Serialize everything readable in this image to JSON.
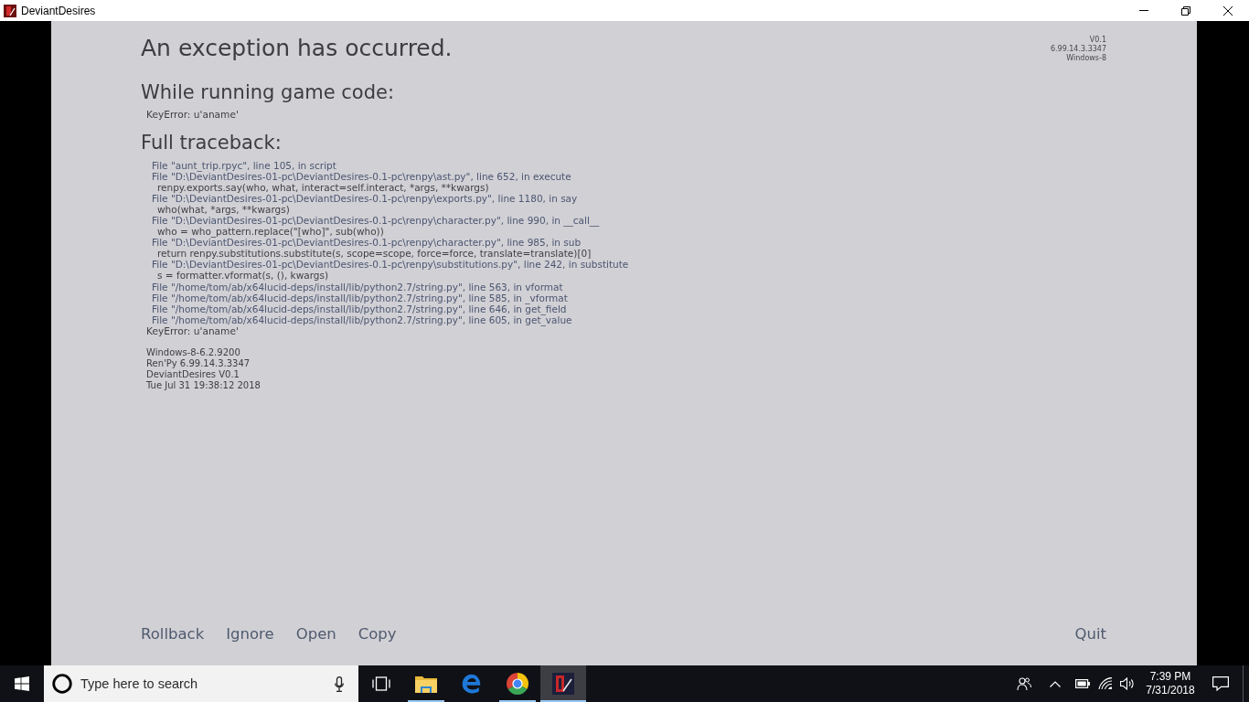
{
  "window": {
    "title": "DeviantDesires"
  },
  "version_info": [
    "V0.1",
    "6.99.14.3.3347",
    "Windows-8"
  ],
  "exception": {
    "heading": "An exception has occurred.",
    "game_code": {
      "heading": "While running game code:",
      "lines": [
        "KeyError: u'aname'"
      ]
    },
    "traceback": {
      "heading": "Full traceback:",
      "lines": [
        {
          "kind": "frame",
          "text": "File \"aunt_trip.rpyc\", line 105, in script"
        },
        {
          "kind": "frame",
          "text": "File \"D:\\DeviantDesires-01-pc\\DeviantDesires-0.1-pc\\renpy\\ast.py\", line 652, in execute"
        },
        {
          "kind": "code",
          "text": "renpy.exports.say(who, what, interact=self.interact, *args, **kwargs)"
        },
        {
          "kind": "frame",
          "text": "File \"D:\\DeviantDesires-01-pc\\DeviantDesires-0.1-pc\\renpy\\exports.py\", line 1180, in say"
        },
        {
          "kind": "code",
          "text": "who(what, *args, **kwargs)"
        },
        {
          "kind": "frame",
          "text": "File \"D:\\DeviantDesires-01-pc\\DeviantDesires-0.1-pc\\renpy\\character.py\", line 990, in __call__"
        },
        {
          "kind": "code",
          "text": "who = who_pattern.replace(\"[who]\", sub(who))"
        },
        {
          "kind": "frame",
          "text": "File \"D:\\DeviantDesires-01-pc\\DeviantDesires-0.1-pc\\renpy\\character.py\", line 985, in sub"
        },
        {
          "kind": "code",
          "text": "return renpy.substitutions.substitute(s, scope=scope, force=force, translate=translate)[0]"
        },
        {
          "kind": "frame",
          "text": "File \"D:\\DeviantDesires-01-pc\\DeviantDesires-0.1-pc\\renpy\\substitutions.py\", line 242, in substitute"
        },
        {
          "kind": "code",
          "text": "s = formatter.vformat(s, (), kwargs)"
        },
        {
          "kind": "frame",
          "text": "File \"/home/tom/ab/x64lucid-deps/install/lib/python2.7/string.py\", line 563, in vformat"
        },
        {
          "kind": "frame",
          "text": "File \"/home/tom/ab/x64lucid-deps/install/lib/python2.7/string.py\", line 585, in _vformat"
        },
        {
          "kind": "frame",
          "text": "File \"/home/tom/ab/x64lucid-deps/install/lib/python2.7/string.py\", line 646, in get_field"
        },
        {
          "kind": "frame",
          "text": "File \"/home/tom/ab/x64lucid-deps/install/lib/python2.7/string.py\", line 605, in get_value"
        },
        {
          "kind": "error",
          "text": "KeyError: u'aname'"
        }
      ]
    },
    "system_info": [
      "Windows-8-6.2.9200",
      "Ren'Py 6.99.14.3.3347",
      "DeviantDesires V0.1",
      "Tue Jul 31 19:38:12 2018"
    ]
  },
  "actions": [
    {
      "label": "Rollback"
    },
    {
      "label": "Ignore"
    },
    {
      "label": "Open"
    },
    {
      "label": "Copy"
    }
  ],
  "quit": {
    "label": "Quit"
  },
  "taskbar": {
    "search": {
      "placeholder": "Type here to search"
    },
    "apps": [
      {
        "kind": "folder",
        "running": true,
        "selected": false
      },
      {
        "kind": "letter_e",
        "running": false,
        "selected": false
      },
      {
        "kind": "ring",
        "running": true,
        "selected": false
      },
      {
        "kind": "game",
        "running": true,
        "selected": true
      }
    ],
    "clock": {
      "time": "7:39 PM",
      "date": "7/31/2018"
    }
  }
}
